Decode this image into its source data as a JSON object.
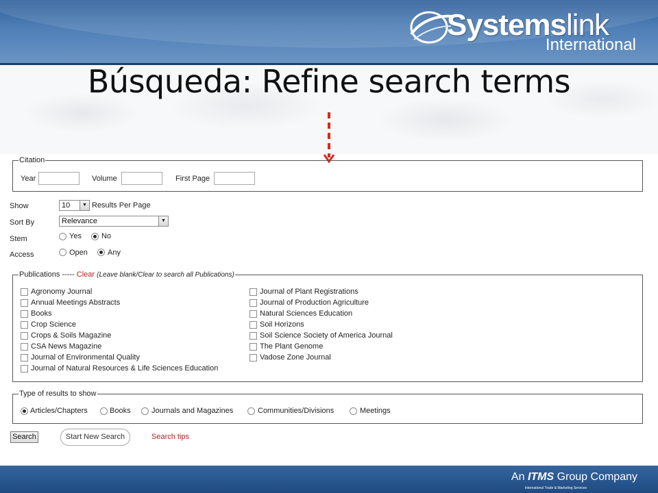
{
  "slide": {
    "title": "Búsqueda: Refine search terms",
    "logo_main_bold": "Systems",
    "logo_main_light": "link",
    "logo_sub": "International",
    "tagline_prefix": "An",
    "tagline_brand": "ITMS",
    "tagline_suffix": "Group Company",
    "tagline_small": "International Trade & Marketing Services"
  },
  "citation": {
    "legend": "Citation",
    "year_label": "Year",
    "year_value": "",
    "volume_label": "Volume",
    "volume_value": "",
    "first_page_label": "First Page",
    "first_page_value": ""
  },
  "options": {
    "show_label": "Show",
    "show_value": "10",
    "show_suffix": "Results Per Page",
    "sort_label": "Sort By",
    "sort_value": "Relevance",
    "stem_label": "Stem",
    "stem_yes": "Yes",
    "stem_no": "No",
    "stem_selected": "No",
    "access_label": "Access",
    "access_open": "Open",
    "access_any": "Any",
    "access_selected": "Any"
  },
  "publications": {
    "legend_prefix": "Publications -----",
    "clear_label": "Clear",
    "note": "(Leave blank/Clear to search all Publications)",
    "left": [
      "Agronomy Journal",
      "Annual Meetings Abstracts",
      "Books",
      "Crop Science",
      "Crops & Soils Magazine",
      "CSA News Magazine",
      "Journal of Environmental Quality",
      "Journal of Natural Resources & Life Sciences Education"
    ],
    "right": [
      "Journal of Plant Registrations",
      "Journal of Production Agriculture",
      "Natural Sciences Education",
      "Soil Horizons",
      "Soil Science Society of America Journal",
      "The Plant Genome",
      "Vadose Zone Journal"
    ]
  },
  "result_types": {
    "legend": "Type of results to show",
    "options": [
      "Articles/Chapters",
      "Books",
      "Journals and Magazines",
      "Communities/Divisions",
      "Meetings"
    ],
    "selected": "Articles/Chapters"
  },
  "actions": {
    "search_label": "Search",
    "new_search_label": "Start New Search",
    "tips_label": "Search tips"
  },
  "colors": {
    "header_blue": "#4f7fb6",
    "footer_blue": "#1f4a80",
    "link_red": "#b22222",
    "arrow_red": "#e0261b"
  }
}
